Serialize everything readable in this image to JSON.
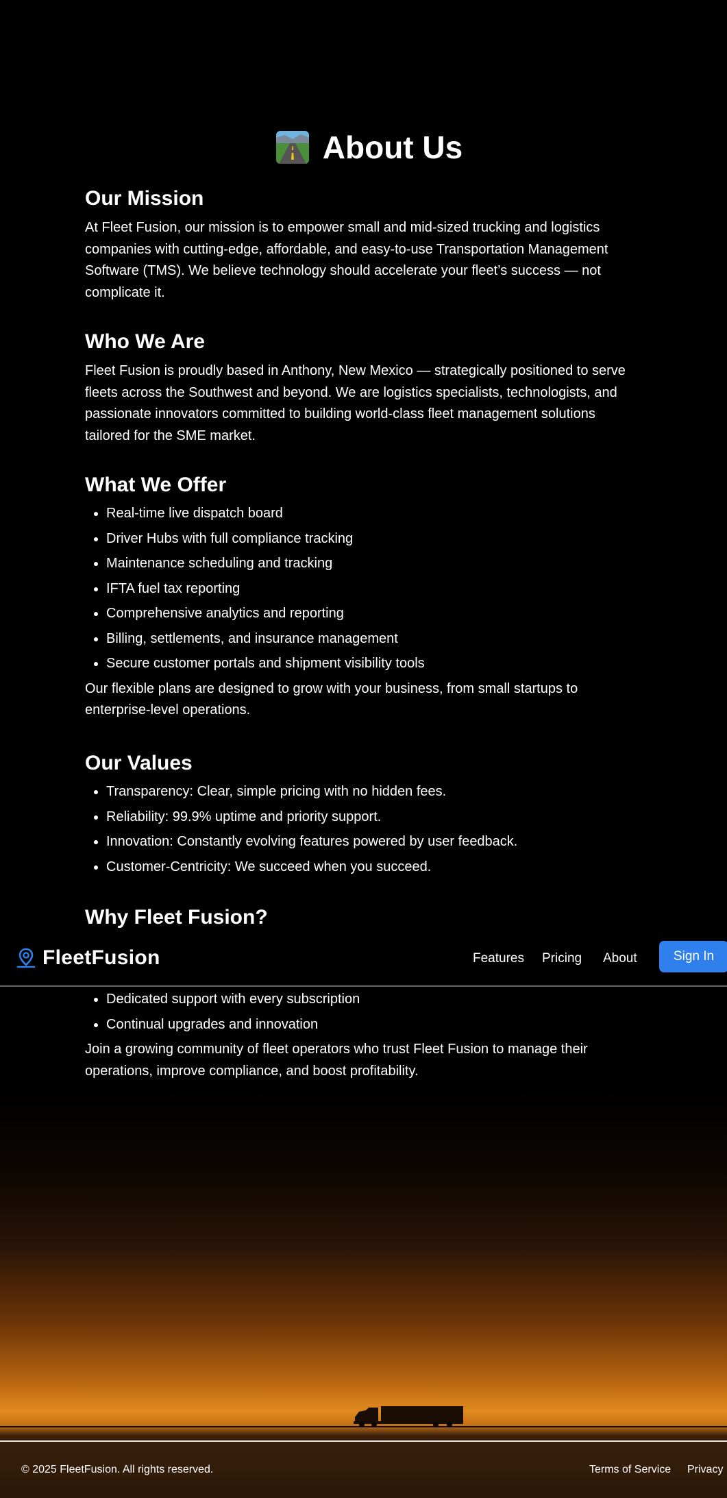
{
  "page": {
    "title": "About Us",
    "title_icon": "highway-icon"
  },
  "sections": {
    "mission": {
      "heading": "Our Mission",
      "lines": [
        "At Fleet Fusion, our mission is to empower small and mid-sized trucking and logistics",
        "companies with cutting-edge, affordable, and easy-to-use Transportation Management",
        "Software (TMS). We believe technology should accelerate your fleet’s success — not",
        "complicate it."
      ]
    },
    "who": {
      "heading": "Who We Are",
      "lines": [
        "Fleet Fusion is proudly based in Anthony, New Mexico — strategically positioned to serve",
        "fleets across the Southwest and beyond. We are logistics specialists, technologists, and",
        "passionate innovators committed to building world-class fleet management solutions",
        "tailored for the SME market."
      ]
    },
    "offer": {
      "heading": "What We Offer",
      "items": [
        "Real-time live dispatch board",
        "Driver Hubs with full compliance tracking",
        "Maintenance scheduling and tracking",
        "IFTA fuel tax reporting",
        "Comprehensive analytics and reporting",
        "Billing, settlements, and insurance management",
        "Secure customer portals and shipment visibility tools"
      ],
      "closing_lines": [
        "Our flexible plans are designed to grow with your business, from small startups to",
        "enterprise-level operations."
      ]
    },
    "values": {
      "heading": "Our Values",
      "items": [
        "Transparency: Clear, simple pricing with no hidden fees.",
        "Reliability: 99.9% uptime and priority support.",
        "Innovation: Constantly evolving features powered by user feedback.",
        "Customer-Centricity: We succeed when you succeed."
      ]
    },
    "why": {
      "heading": "Why Fleet Fusion?",
      "items": [
        "Dedicated support with every subscription",
        "Continual upgrades and innovation"
      ],
      "closing_lines": [
        "Join a growing community of fleet operators who trust Fleet Fusion to manage their",
        "operations, improve compliance, and boost profitability."
      ]
    }
  },
  "navbar": {
    "brand": "FleetFusion",
    "logo_icon": "map-pin-icon",
    "links": [
      "Features",
      "Pricing",
      "About"
    ],
    "signin_label": "Sign In",
    "accent": "#2f80ed"
  },
  "footer": {
    "copyright": "© 2025 FleetFusion. All rights reserved.",
    "links": [
      "Terms of Service",
      "Privacy"
    ]
  },
  "colors": {
    "background": "#000000",
    "sunset_orange": "#e08a1e",
    "text": "#ffffff"
  }
}
